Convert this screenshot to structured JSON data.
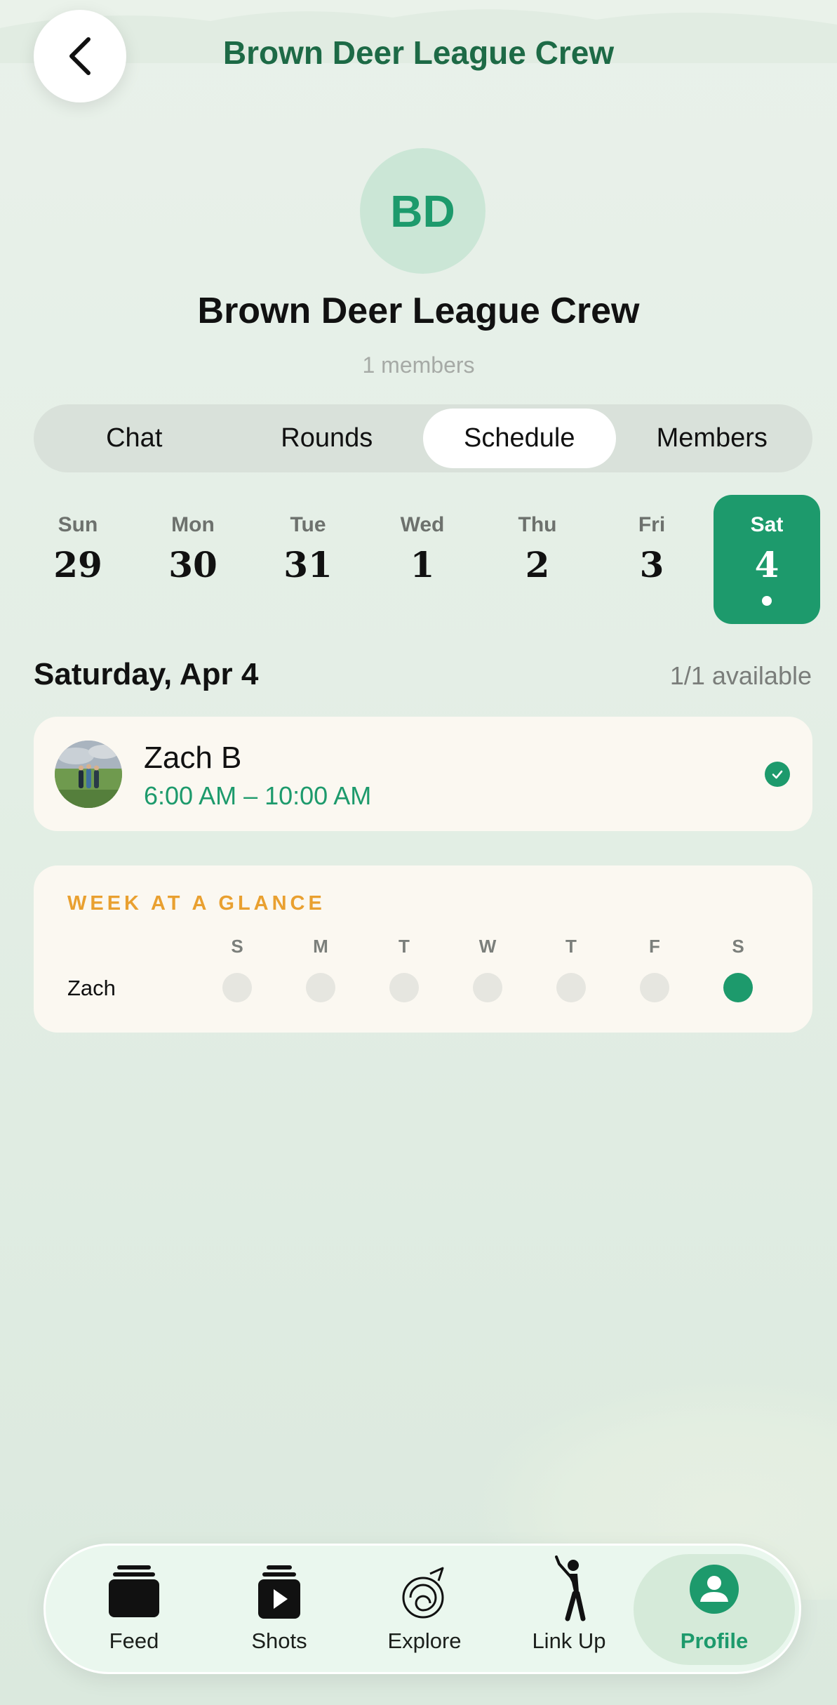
{
  "header": {
    "title": "Brown Deer League Crew",
    "back_icon": "chevron-left-icon"
  },
  "group": {
    "initials": "BD",
    "name": "Brown Deer League Crew",
    "member_count": "1 members"
  },
  "tabs": [
    {
      "label": "Chat",
      "active": false
    },
    {
      "label": "Rounds",
      "active": false
    },
    {
      "label": "Schedule",
      "active": true
    },
    {
      "label": "Members",
      "active": false
    }
  ],
  "days": [
    {
      "name": "Sun",
      "num": "29",
      "selected": false
    },
    {
      "name": "Mon",
      "num": "30",
      "selected": false
    },
    {
      "name": "Tue",
      "num": "31",
      "selected": false
    },
    {
      "name": "Wed",
      "num": "1",
      "selected": false
    },
    {
      "name": "Thu",
      "num": "2",
      "selected": false
    },
    {
      "name": "Fri",
      "num": "3",
      "selected": false
    },
    {
      "name": "Sat",
      "num": "4",
      "selected": true
    }
  ],
  "schedule": {
    "date_title": "Saturday, Apr 4",
    "availability": "1/1 available",
    "entries": [
      {
        "name": "Zach B",
        "time": "6:00 AM – 10:00 AM",
        "confirmed": true
      }
    ]
  },
  "week": {
    "title": "WEEK AT A GLANCE",
    "day_headers": [
      "S",
      "M",
      "T",
      "W",
      "T",
      "F",
      "S"
    ],
    "rows": [
      {
        "name": "Zach",
        "available": [
          false,
          false,
          false,
          false,
          false,
          false,
          true
        ]
      }
    ]
  },
  "nav": {
    "items": [
      {
        "label": "Feed",
        "icon": "feed-stack-icon",
        "active": false
      },
      {
        "label": "Shots",
        "icon": "shots-play-icon",
        "active": false
      },
      {
        "label": "Explore",
        "icon": "explore-swirl-icon",
        "active": false
      },
      {
        "label": "Link Up",
        "icon": "golfer-icon",
        "active": false
      },
      {
        "label": "Profile",
        "icon": "profile-person-icon",
        "active": true
      }
    ]
  },
  "colors": {
    "accent": "#1d9a6c",
    "header_text": "#1d6a46",
    "week_title": "#e9a030",
    "card_bg": "#fbf8f1"
  }
}
